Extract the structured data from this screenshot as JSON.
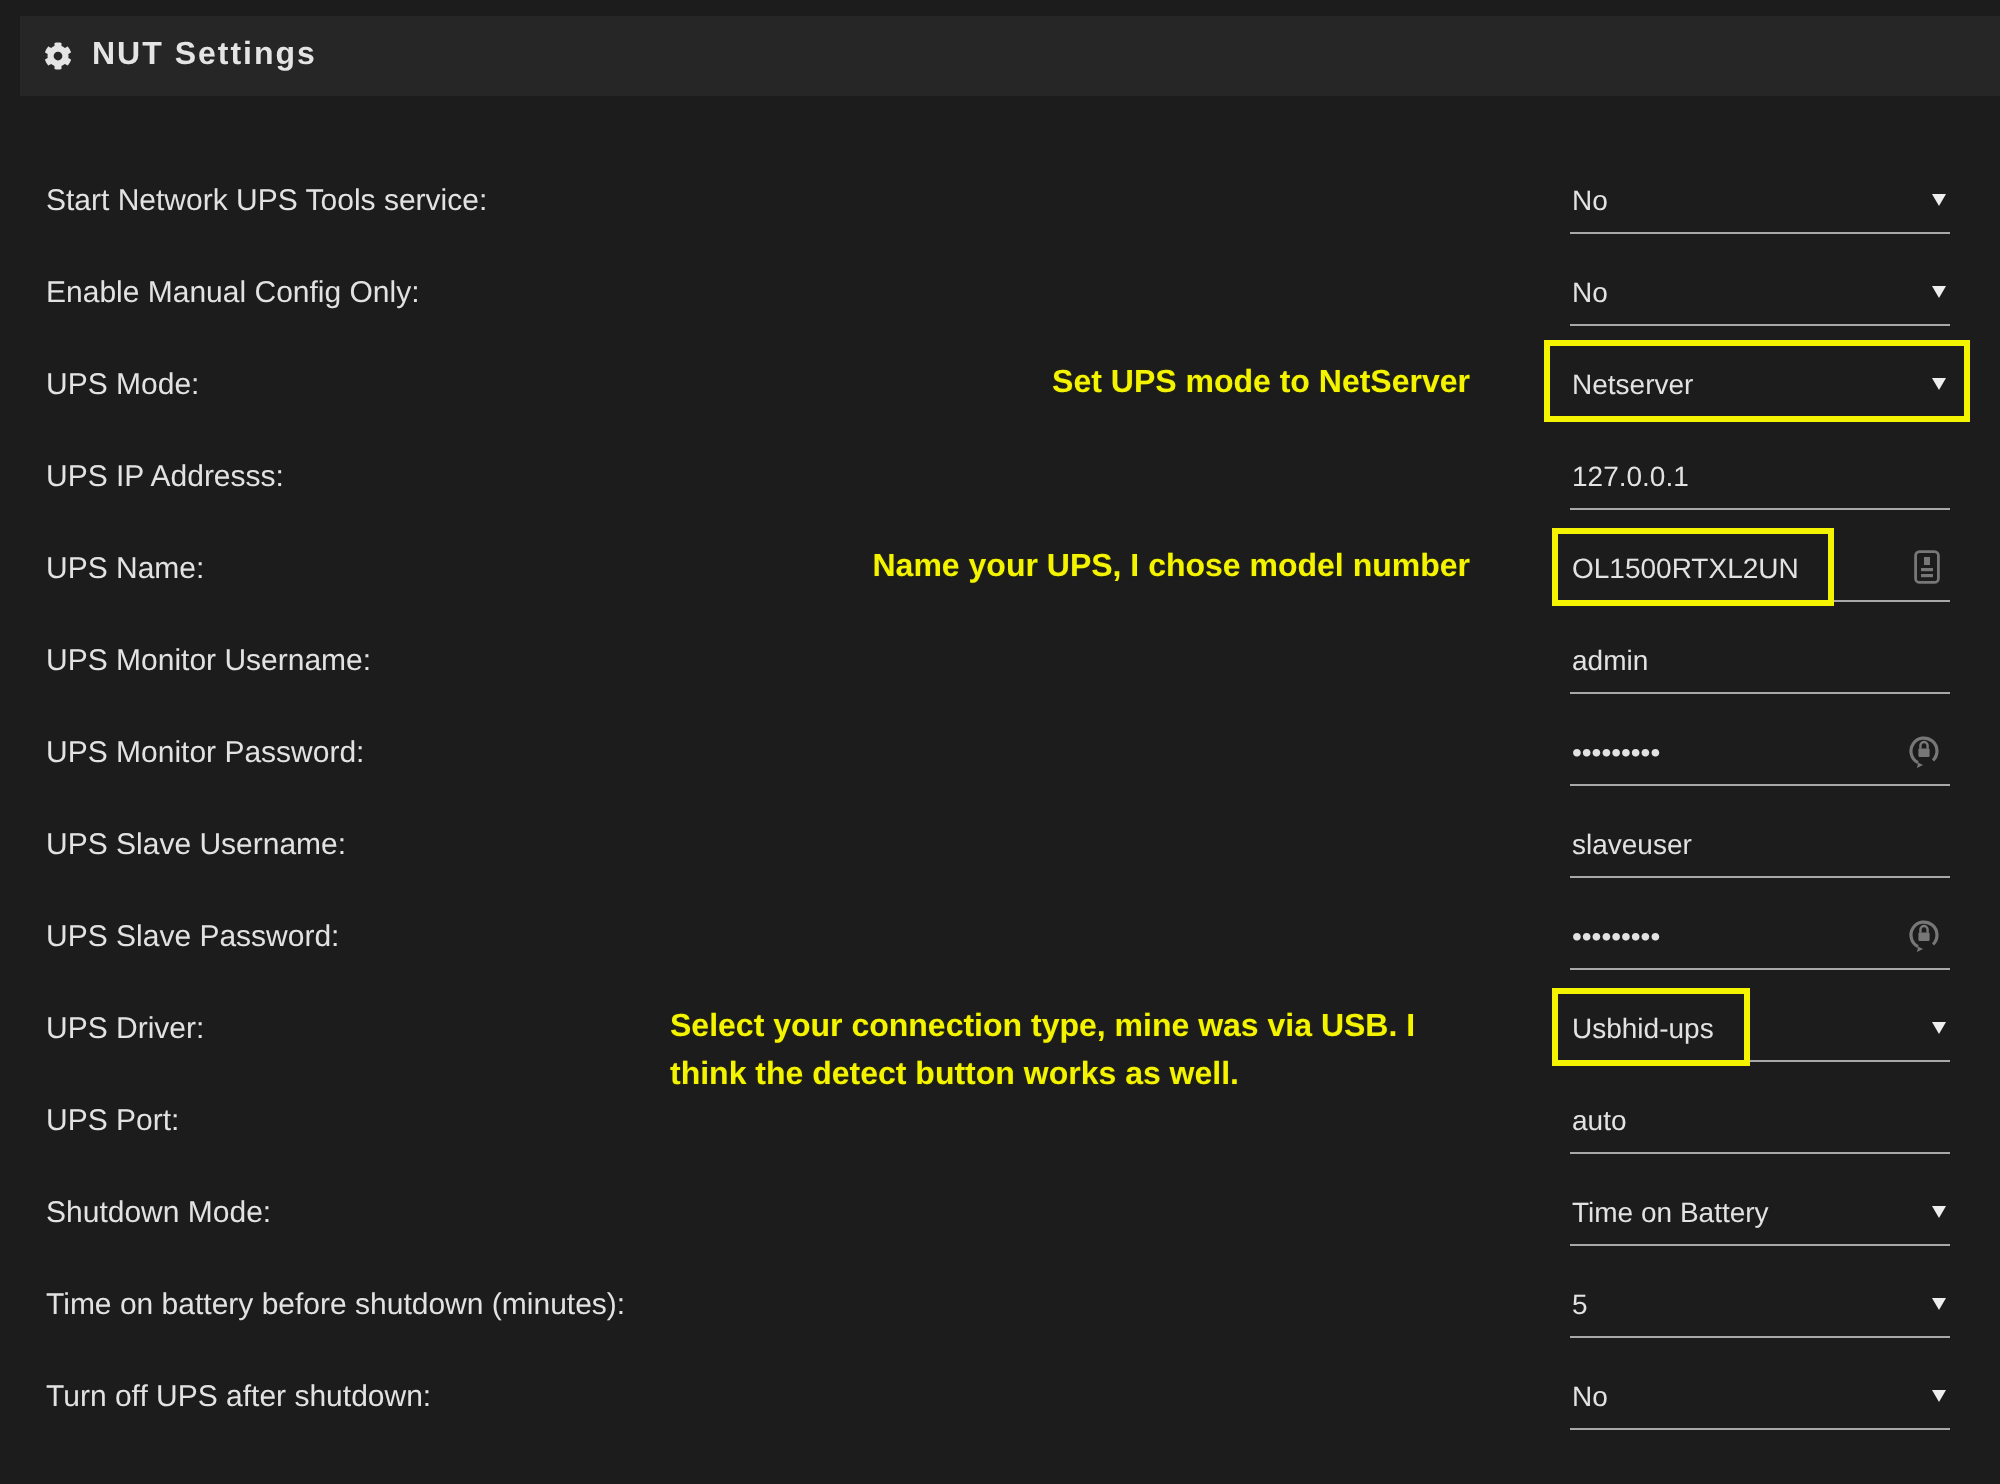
{
  "panel": {
    "title": "NUT Settings"
  },
  "settings": [
    {
      "label": "Start Network UPS Tools service:",
      "kind": "select",
      "value": "No"
    },
    {
      "label": "Enable Manual Config Only:",
      "kind": "select",
      "value": "No"
    },
    {
      "label": "UPS Mode:",
      "kind": "select",
      "value": "Netserver",
      "highlight": {
        "kind": "field"
      },
      "note": "Set UPS mode to NetServer"
    },
    {
      "label": "UPS IP Addresss:",
      "kind": "text",
      "value": "127.0.0.1"
    },
    {
      "label": "UPS Name:",
      "kind": "text-action",
      "value": "OL1500RTXL2UN",
      "highlight": {
        "kind": "value"
      },
      "note": "Name your UPS, I chose model number"
    },
    {
      "label": "UPS Monitor Username:",
      "kind": "text",
      "value": "admin"
    },
    {
      "label": "UPS Monitor Password:",
      "kind": "password",
      "value": "•••••••••"
    },
    {
      "label": "UPS Slave Username:",
      "kind": "text",
      "value": "slaveuser"
    },
    {
      "label": "UPS Slave Password:",
      "kind": "password",
      "value": "•••••••••"
    },
    {
      "label": "UPS Driver:",
      "kind": "select",
      "value": "Usbhid-ups",
      "highlight": {
        "kind": "value"
      },
      "note": "Select your connection type, mine was via USB. I think the detect button works as well."
    },
    {
      "label": "UPS Port:",
      "kind": "text",
      "value": "auto"
    },
    {
      "label": "Shutdown Mode:",
      "kind": "select",
      "value": "Time on Battery"
    },
    {
      "label": "Time on battery before shutdown (minutes):",
      "kind": "select",
      "value": "5"
    },
    {
      "label": "Turn off UPS after shutdown:",
      "kind": "select",
      "value": "No"
    }
  ]
}
